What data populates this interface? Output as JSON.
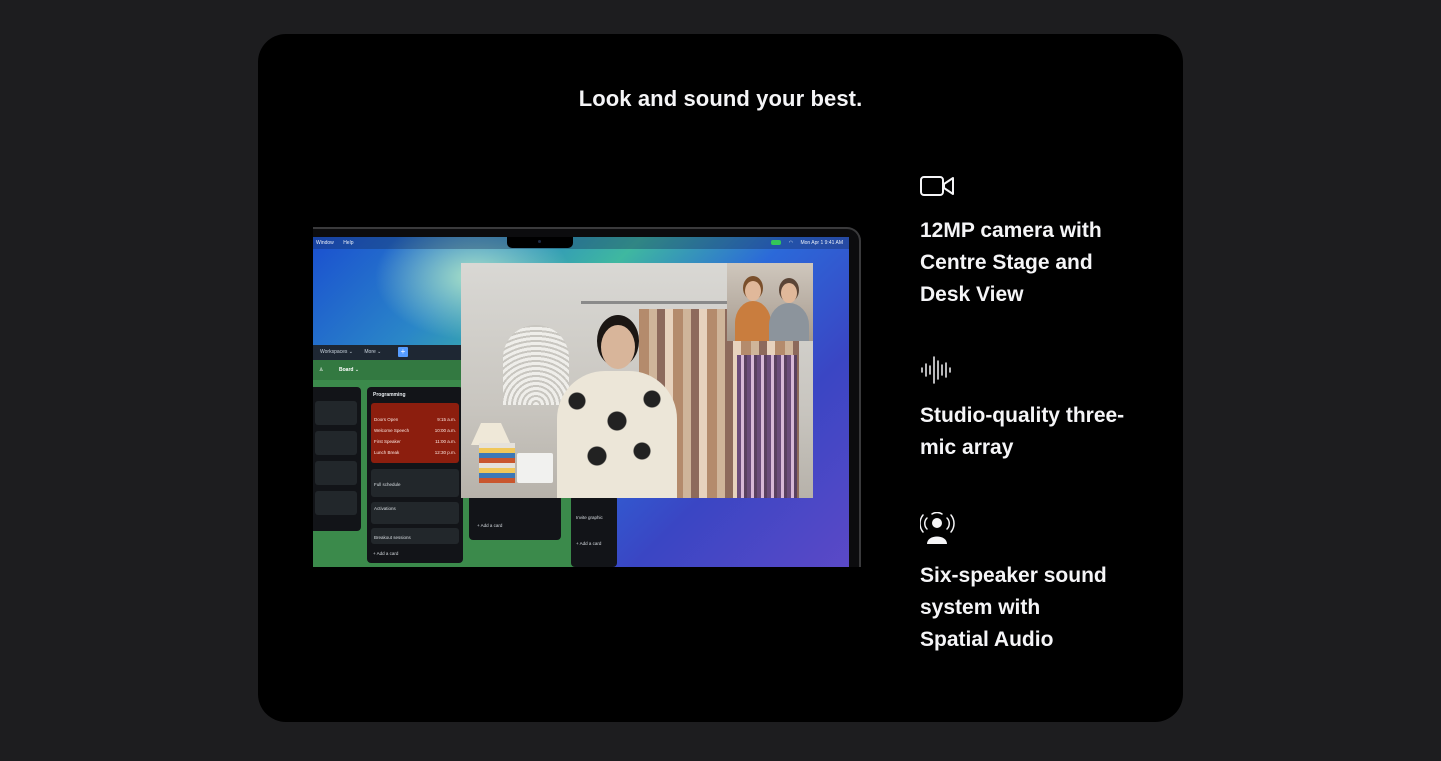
{
  "section": {
    "headline": "Look and sound your best."
  },
  "laptop_screen": {
    "menubar": {
      "left_items": [
        "Window",
        "Help"
      ],
      "right_text": "Mon Apr 1  9:41 AM"
    },
    "board": {
      "topbar_items": [
        "Workspaces ⌄",
        "More ⌄"
      ],
      "plus": "+",
      "board_label": "Board ⌄",
      "columns": {
        "programming": {
          "title": "Programming",
          "schedule": [
            {
              "label": "Doors Open",
              "time": "9:15 a.m."
            },
            {
              "label": "Welcome Speech",
              "time": "10:00 a.m."
            },
            {
              "label": "First Speaker",
              "time": "11:00 a.m."
            },
            {
              "label": "Lunch Break",
              "time": "12:30 p.m."
            }
          ],
          "full_schedule": "Full schedule",
          "activations": "Activations",
          "breakout": "Breakout sessions",
          "add_card": "+ Add a card"
        },
        "third": {
          "add_card": "+ Add a card"
        },
        "fourth": {
          "invite": "Invite graphic",
          "add_card": "+ Add a card"
        }
      }
    }
  },
  "features": [
    {
      "icon": "video-camera-icon",
      "text": "12MP camera with\nCentre Stage and\nDesk View"
    },
    {
      "icon": "sound-wave-icon",
      "text": "Studio-quality three-\nmic array"
    },
    {
      "icon": "spatial-audio-icon",
      "text": "Six-speaker sound\nsystem with\nSpatial Audio"
    }
  ],
  "colors": {
    "page_bg": "#1d1d1f",
    "card_bg": "#000000",
    "text": "#f5f5f7",
    "board_green": "#3b8a4b",
    "facetime_green": "#34c759"
  }
}
